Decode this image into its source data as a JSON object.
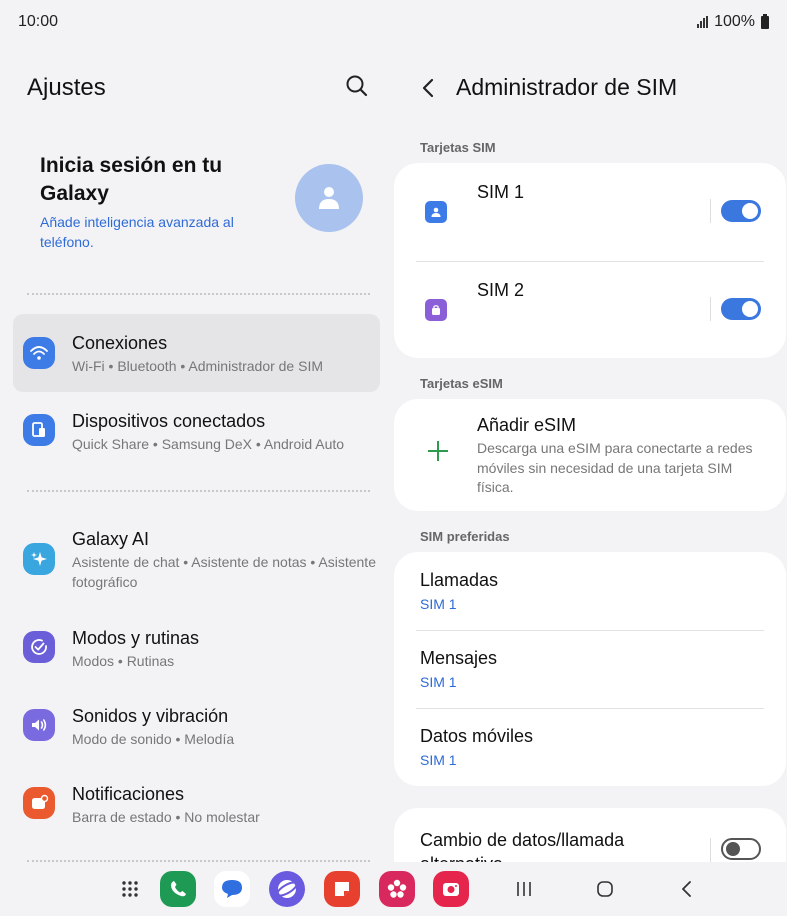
{
  "status": {
    "time": "10:00",
    "battery": "100%"
  },
  "left": {
    "title": "Ajustes",
    "profile": {
      "title": "Inicia sesión en tu Galaxy",
      "subtitle": "Añade inteligencia avanzada al teléfono."
    },
    "items": [
      {
        "title": "Conexiones",
        "subtitle": "Wi-Fi  •  Bluetooth  •  Administrador de SIM",
        "icon": "wifi-icon",
        "color": "#3d7be6"
      },
      {
        "title": "Dispositivos conectados",
        "subtitle": "Quick Share  •  Samsung DeX  •  Android Auto",
        "icon": "devices-icon",
        "color": "#3d7be6"
      },
      {
        "title": "Galaxy AI",
        "subtitle": "Asistente de chat  •  Asistente de notas  •  Asistente fotográfico",
        "icon": "sparkle-icon",
        "color": "#3aa6e0"
      },
      {
        "title": "Modos y rutinas",
        "subtitle": "Modos  •  Rutinas",
        "icon": "check-circle-icon",
        "color": "#6a5fd8"
      },
      {
        "title": "Sonidos y vibración",
        "subtitle": "Modo de sonido  •  Melodía",
        "icon": "speaker-icon",
        "color": "#7a6ae0"
      },
      {
        "title": "Notificaciones",
        "subtitle": "Barra de estado  •  No molestar",
        "icon": "notification-icon",
        "color": "#ea5a2e"
      }
    ]
  },
  "right": {
    "title": "Administrador de SIM",
    "sections": {
      "sim_cards": "Tarjetas SIM",
      "esim_cards": "Tarjetas eSIM",
      "preferred": "SIM preferidas"
    },
    "sims": [
      {
        "label": "SIM 1",
        "enabled": true,
        "color": "#3d7be6"
      },
      {
        "label": "SIM 2",
        "enabled": true,
        "color": "#8a5fd8"
      }
    ],
    "esim": {
      "title": "Añadir eSIM",
      "subtitle": "Descarga una eSIM para conectarte a redes móviles sin necesidad de una tarjeta SIM física."
    },
    "preferred": [
      {
        "title": "Llamadas",
        "value": "SIM 1"
      },
      {
        "title": "Mensajes",
        "value": "SIM 1"
      },
      {
        "title": "Datos móviles",
        "value": "SIM 1"
      }
    ],
    "switch_item": {
      "title": "Cambio de datos/llamada alternativa",
      "enabled": false
    }
  },
  "colors": {
    "accent": "#3a78e0",
    "link": "#2e6bd6",
    "background": "#f3f3f5"
  }
}
